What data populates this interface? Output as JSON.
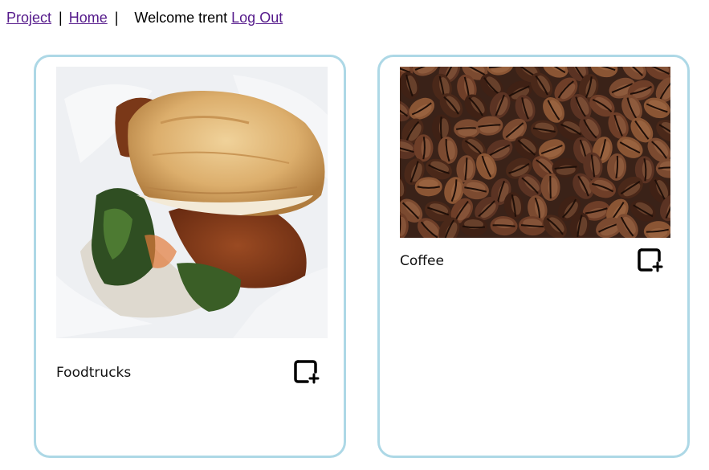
{
  "nav": {
    "project_link": "Project",
    "separator": "|",
    "home_link": "Home",
    "welcome_text": "Welcome trent",
    "logout_link": "Log Out"
  },
  "cards": [
    {
      "label": "Foodtrucks",
      "image": "fried-chicken-biscuit-sandwich-photo",
      "action_icon": "add-to-collection-icon"
    },
    {
      "label": "Coffee",
      "image": "coffee-beans-photo",
      "action_icon": "add-to-collection-icon"
    }
  ],
  "colors": {
    "card_border": "#add8e6",
    "link": "#551a8b"
  }
}
